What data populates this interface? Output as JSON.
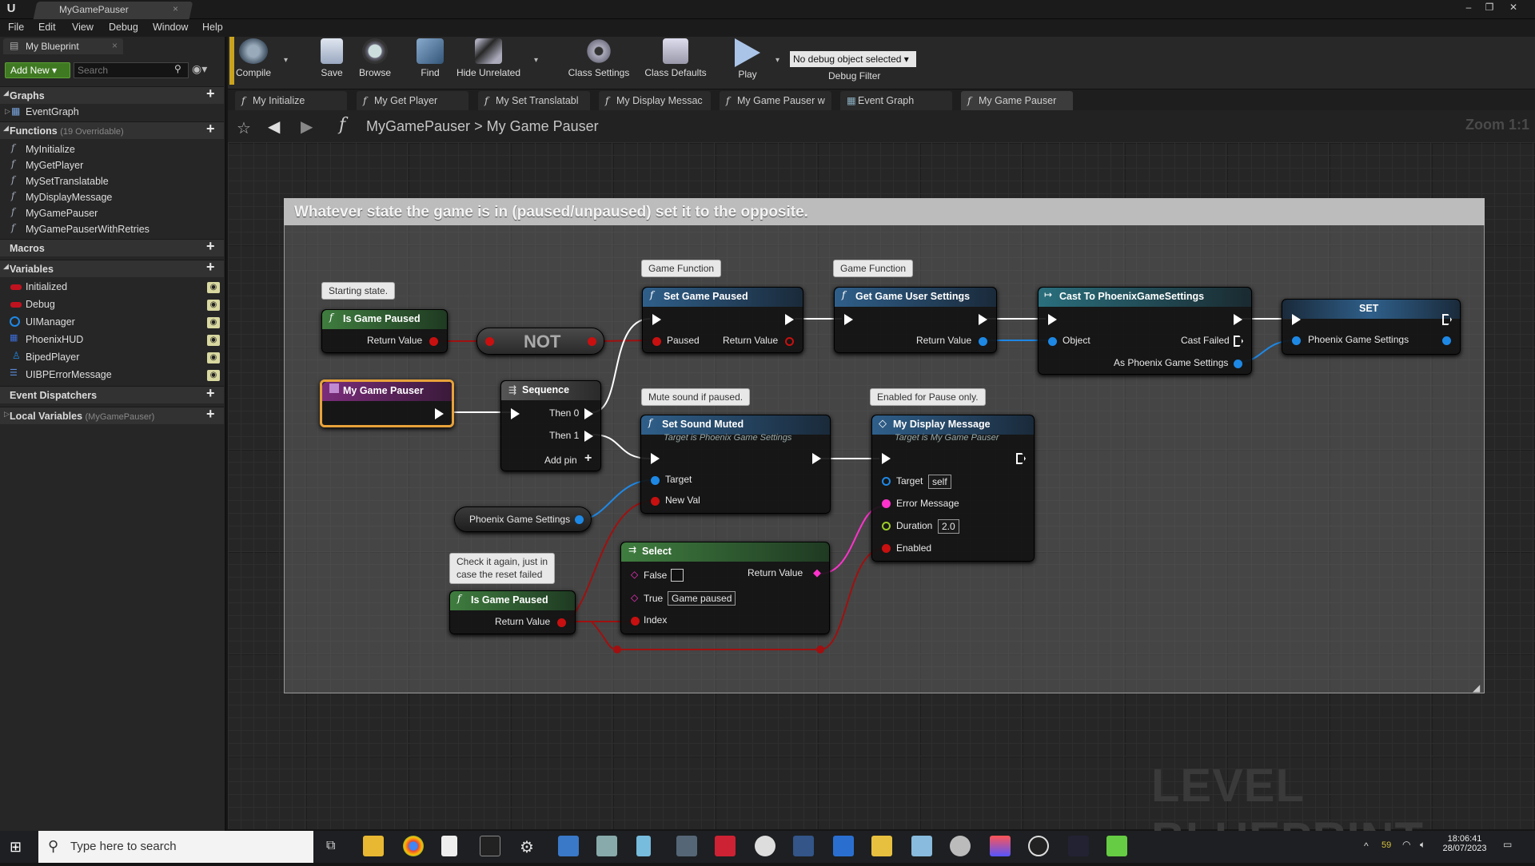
{
  "window": {
    "title": "MyGamePauser"
  },
  "menu": [
    "File",
    "Edit",
    "View",
    "Debug",
    "Window",
    "Help"
  ],
  "left_panel": {
    "tab": "My Blueprint",
    "add_new": "Add New",
    "search_placeholder": "Search",
    "graphs": {
      "label": "Graphs",
      "items": [
        "EventGraph"
      ]
    },
    "functions": {
      "label": "Functions",
      "note": "(19 Overridable)",
      "items": [
        "MyInitialize",
        "MyGetPlayer",
        "MySetTranslatable",
        "MyDisplayMessage",
        "MyGamePauser",
        "MyGamePauserWithRetries"
      ]
    },
    "macros": {
      "label": "Macros"
    },
    "variables": {
      "label": "Variables",
      "items": [
        {
          "name": "Initialized",
          "color": "#c1121f"
        },
        {
          "name": "Debug",
          "color": "#c1121f"
        },
        {
          "name": "UIManager",
          "color": "#1e88e5"
        },
        {
          "name": "PhoenixHUD",
          "color": "#3c6dd8"
        },
        {
          "name": "BipedPlayer",
          "color": "#1e88e5"
        },
        {
          "name": "UIBPErrorMessage",
          "color": "#5a8ad8"
        }
      ]
    },
    "event_dispatchers": {
      "label": "Event Dispatchers"
    },
    "local_variables": {
      "label": "Local Variables",
      "note": "(MyGamePauser)"
    }
  },
  "toolbar": {
    "compile": "Compile",
    "save": "Save",
    "browse": "Browse",
    "find": "Find",
    "hide_unrelated": "Hide Unrelated",
    "class_settings": "Class Settings",
    "class_defaults": "Class Defaults",
    "play": "Play",
    "debug_select": "No debug object selected",
    "debug_filter": "Debug Filter"
  },
  "tabs": [
    "My Initialize",
    "My Get Player",
    "My Set Translatabl",
    "My Display Messac",
    "My Game Pauser w",
    "Event Graph",
    "My Game Pauser"
  ],
  "breadcrumb": {
    "root": "MyGamePauser",
    "sep": ">",
    "leaf": "My Game Pauser"
  },
  "zoom": "Zoom 1:1",
  "graph": {
    "comment": "Whatever state the game is in (paused/unpaused) set it to the opposite.",
    "bubbles": {
      "starting": "Starting state.",
      "gf1": "Game Function",
      "gf2": "Game Function",
      "mute": "Mute sound if paused.",
      "enabled": "Enabled for Pause only.",
      "check1": "Check it again, just in",
      "check2": "case the reset failed"
    },
    "nodes": {
      "is_paused_1": {
        "title": "Is Game Paused",
        "out": "Return Value"
      },
      "not": {
        "title": "NOT"
      },
      "entry": {
        "title": "My Game Pauser"
      },
      "sequence": {
        "title": "Sequence",
        "then0": "Then 0",
        "then1": "Then 1",
        "add": "Add pin"
      },
      "set_paused": {
        "title": "Set Game Paused",
        "paused": "Paused",
        "out": "Return Value"
      },
      "get_settings": {
        "title": "Get Game User Settings",
        "out": "Return Value"
      },
      "cast": {
        "title": "Cast To PhoenixGameSettings",
        "object": "Object",
        "failed": "Cast Failed",
        "as": "As Phoenix Game Settings"
      },
      "set": {
        "title": "SET",
        "pin": "Phoenix Game Settings"
      },
      "sound": {
        "title": "Set Sound Muted",
        "sub": "Target is Phoenix Game Settings",
        "target": "Target",
        "newval": "New Val"
      },
      "display": {
        "title": "My Display Message",
        "sub": "Target is My Game Pauser",
        "target": "Target",
        "self": "self",
        "err": "Error Message",
        "dur": "Duration",
        "dur_val": "2.0",
        "enabled": "Enabled"
      },
      "var": {
        "title": "Phoenix Game Settings"
      },
      "select": {
        "title": "Select",
        "false": "False",
        "true": "True",
        "true_val": "Game paused",
        "index": "Index",
        "out": "Return Value"
      },
      "is_paused_2": {
        "title": "Is Game Paused",
        "out": "Return Value"
      }
    },
    "watermark": "LEVEL BLUEPRINT"
  },
  "taskbar": {
    "search": "Type here to search",
    "time": "18:06:41",
    "date": "28/07/2023",
    "temp": "59"
  }
}
